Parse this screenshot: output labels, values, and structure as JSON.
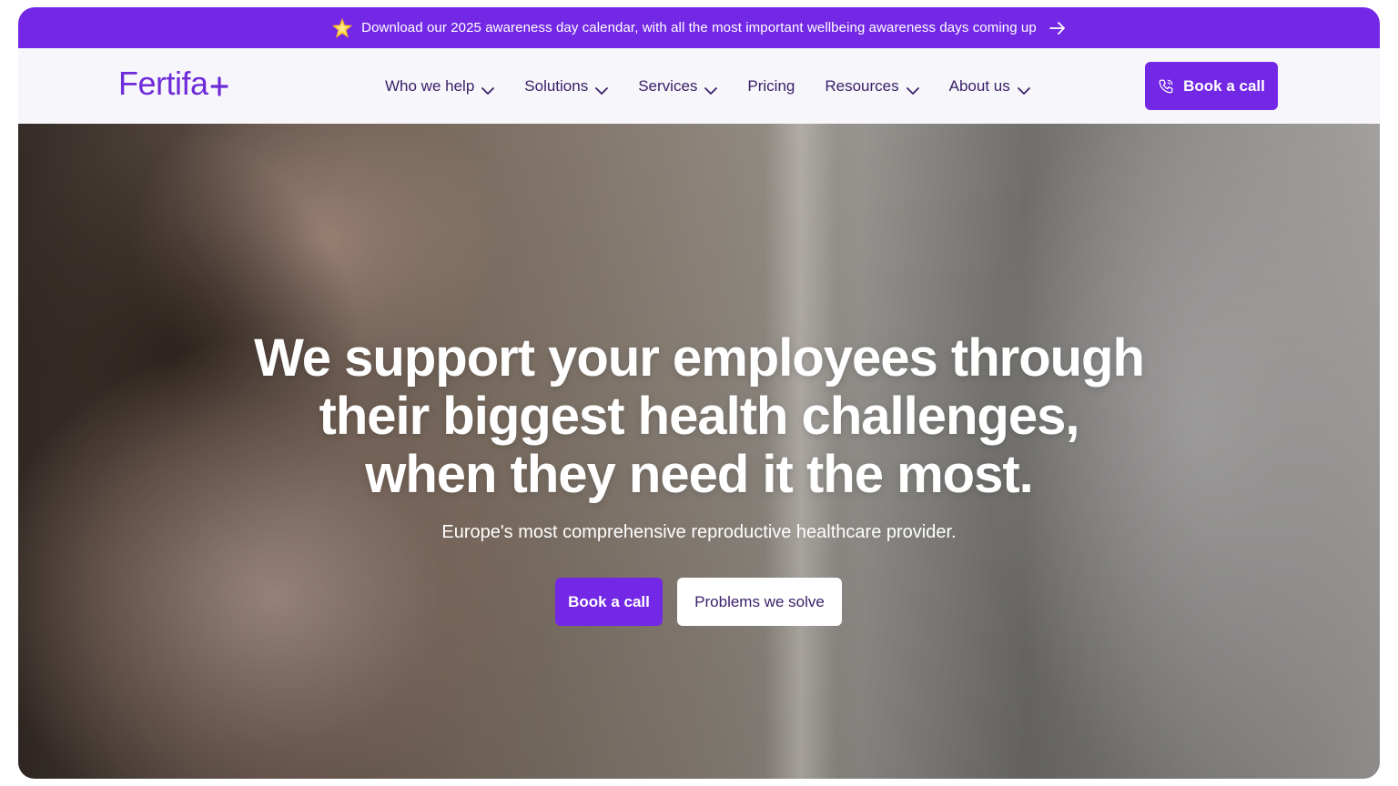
{
  "announcement": {
    "icon": "star-icon",
    "text": "Download our 2025 awareness day calendar, with all the most important wellbeing awareness days coming up"
  },
  "header": {
    "logo_text": "Fertifa",
    "nav": [
      {
        "label": "Who we help",
        "has_dropdown": true
      },
      {
        "label": "Solutions",
        "has_dropdown": true
      },
      {
        "label": "Services",
        "has_dropdown": true
      },
      {
        "label": "Pricing",
        "has_dropdown": false
      },
      {
        "label": "Resources",
        "has_dropdown": true
      },
      {
        "label": "About us",
        "has_dropdown": true
      }
    ],
    "cta_label": "Book a call"
  },
  "hero": {
    "title_lines": [
      "We support your employees through",
      "their biggest health challenges,",
      "when they need it the most."
    ],
    "subtitle": "Europe's most comprehensive reproductive healthcare provider.",
    "primary_button": "Book a call",
    "secondary_button": "Problems we solve"
  },
  "colors": {
    "brand_purple": "#7328e6",
    "nav_text": "#3b2069",
    "header_bg": "#f6f6fb"
  }
}
